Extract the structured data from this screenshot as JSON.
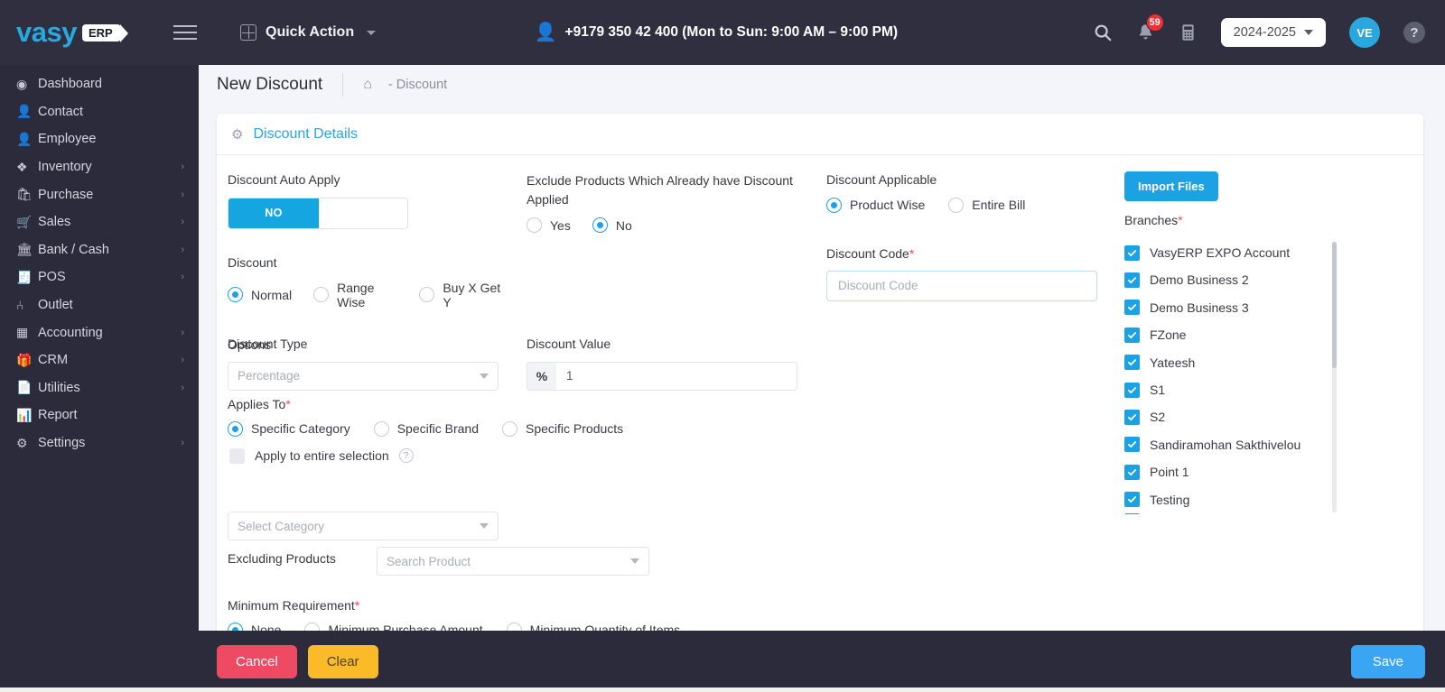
{
  "topbar": {
    "logo_text": "vasy",
    "logo_badge": "ERP",
    "quick_action": "Quick Action",
    "support_phone": "+9179 350 42 400 (Mon to Sun: 9:00 AM – 9:00 PM)",
    "search_icon": "search-icon",
    "notification_count": "59",
    "calculator_icon": "calculator-icon",
    "fiscal_year": "2024-2025",
    "avatar_initials": "VE",
    "help_label": "?"
  },
  "sidebar": {
    "items": [
      {
        "label": "Dashboard",
        "icon": "dashboard-icon",
        "glyph": "◉",
        "expandable": false
      },
      {
        "label": "Contact",
        "icon": "contact-icon",
        "glyph": "👤",
        "expandable": false
      },
      {
        "label": "Employee",
        "icon": "employee-icon",
        "glyph": "👤",
        "expandable": false
      },
      {
        "label": "Inventory",
        "icon": "inventory-icon",
        "glyph": "❖",
        "expandable": true
      },
      {
        "label": "Purchase",
        "icon": "purchase-icon",
        "glyph": "🛍",
        "expandable": true
      },
      {
        "label": "Sales",
        "icon": "sales-icon",
        "glyph": "🛒",
        "expandable": true
      },
      {
        "label": "Bank / Cash",
        "icon": "bank-icon",
        "glyph": "🏛",
        "expandable": true
      },
      {
        "label": "POS",
        "icon": "pos-icon",
        "glyph": "🧾",
        "expandable": true
      },
      {
        "label": "Outlet",
        "icon": "outlet-icon",
        "glyph": "⑃",
        "expandable": false
      },
      {
        "label": "Accounting",
        "icon": "accounting-icon",
        "glyph": "▦",
        "expandable": true
      },
      {
        "label": "CRM",
        "icon": "crm-icon",
        "glyph": "🎁",
        "expandable": true
      },
      {
        "label": "Utilities",
        "icon": "utilities-icon",
        "glyph": "📄",
        "expandable": true
      },
      {
        "label": "Report",
        "icon": "report-icon",
        "glyph": "📊",
        "expandable": false
      },
      {
        "label": "Settings",
        "icon": "settings-icon",
        "glyph": "⚙",
        "expandable": true
      }
    ]
  },
  "page": {
    "title": "New Discount",
    "home_icon": "home-icon",
    "breadcrumb": "- Discount"
  },
  "card": {
    "title": "Discount Details",
    "icon": "gear-icon"
  },
  "form": {
    "auto_apply_label": "Discount Auto Apply",
    "auto_apply_value": "NO",
    "exclude_label": "Exclude Products Which Already have Discount Applied",
    "exclude_options": [
      {
        "label": "Yes",
        "selected": false
      },
      {
        "label": "No",
        "selected": true
      }
    ],
    "applicable_label": "Discount Applicable",
    "applicable_options": [
      {
        "label": "Product Wise",
        "selected": true
      },
      {
        "label": "Entire Bill",
        "selected": false
      }
    ],
    "discount_label": "Discount",
    "discount_options": [
      {
        "label": "Normal",
        "selected": true
      },
      {
        "label": "Range Wise",
        "selected": false
      },
      {
        "label": "Buy X Get Y",
        "selected": false
      }
    ],
    "discount_code_label": "Discount Code",
    "discount_code_required": "*",
    "discount_code_placeholder": "Discount Code",
    "discount_code_value": "",
    "options_label": "Options",
    "discount_type_label": "Discount Type",
    "discount_type_value": "Percentage",
    "discount_value_label": "Discount Value",
    "discount_value_prefix": "%",
    "discount_value": "1",
    "applies_to_label": "Applies To",
    "applies_to_required": "*",
    "applies_to_options": [
      {
        "label": "Specific Category",
        "selected": true
      },
      {
        "label": "Specific Brand",
        "selected": false
      },
      {
        "label": "Specific Products",
        "selected": false
      }
    ],
    "apply_entire_label": "Apply to entire selection",
    "apply_entire_checked": false,
    "help_icon": "question-mark-icon",
    "select_category_placeholder": "Select Category",
    "excluding_products_label": "Excluding Products",
    "search_product_placeholder": "Search Product",
    "minimum_requirement_label": "Minimum Requirement",
    "minimum_requirement_required": "*",
    "minimum_requirement_options": [
      {
        "label": "None",
        "selected": true
      },
      {
        "label": "Minimum Purchase Amount",
        "selected": false
      },
      {
        "label": "Minimum Quantity of Items",
        "selected": false
      }
    ]
  },
  "right_panel": {
    "import_button": "Import Files",
    "branches_label": "Branches",
    "branches_required": "*",
    "branches": [
      {
        "label": "VasyERP EXPO Account",
        "checked": true
      },
      {
        "label": "Demo Business 2",
        "checked": true
      },
      {
        "label": "Demo Business 3",
        "checked": true
      },
      {
        "label": "FZone",
        "checked": true
      },
      {
        "label": "Yateesh",
        "checked": true
      },
      {
        "label": "S1",
        "checked": true
      },
      {
        "label": "S2",
        "checked": true
      },
      {
        "label": "Sandiramohan Sakthivelou",
        "checked": true
      },
      {
        "label": "Point 1",
        "checked": true
      },
      {
        "label": "Testing",
        "checked": true
      }
    ]
  },
  "footer": {
    "cancel_label": "Cancel",
    "clear_label": "Clear",
    "save_label": "Save"
  },
  "colors": {
    "accent": "#1da1e5",
    "sidebar_bg": "#2b2b3b",
    "cancel": "#ef4a63",
    "clear": "#fbbb28",
    "save": "#3aa5f2",
    "required": "#f04a5d"
  }
}
